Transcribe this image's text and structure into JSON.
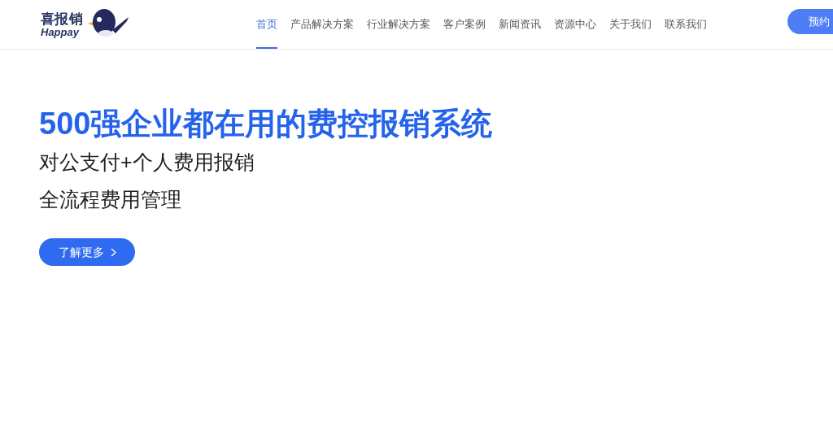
{
  "logo": {
    "name": "喜报销",
    "subtitle": "Happay"
  },
  "nav": [
    {
      "label": "首页",
      "selected": true
    },
    {
      "label": "产品解决方案",
      "selected": false
    },
    {
      "label": "行业解决方案",
      "selected": false
    },
    {
      "label": "客户案例",
      "selected": false
    },
    {
      "label": "新闻资讯",
      "selected": false
    },
    {
      "label": "资源中心",
      "selected": false
    },
    {
      "label": "关于我们",
      "selected": false
    },
    {
      "label": "联系我们",
      "selected": false
    }
  ],
  "cta_button": "预约",
  "hero": {
    "headline": "500强企业都在用的费控报销系统",
    "lines": [
      "对公支付+个人费用报销",
      "全流程费用管理"
    ],
    "button": "了解更多"
  }
}
